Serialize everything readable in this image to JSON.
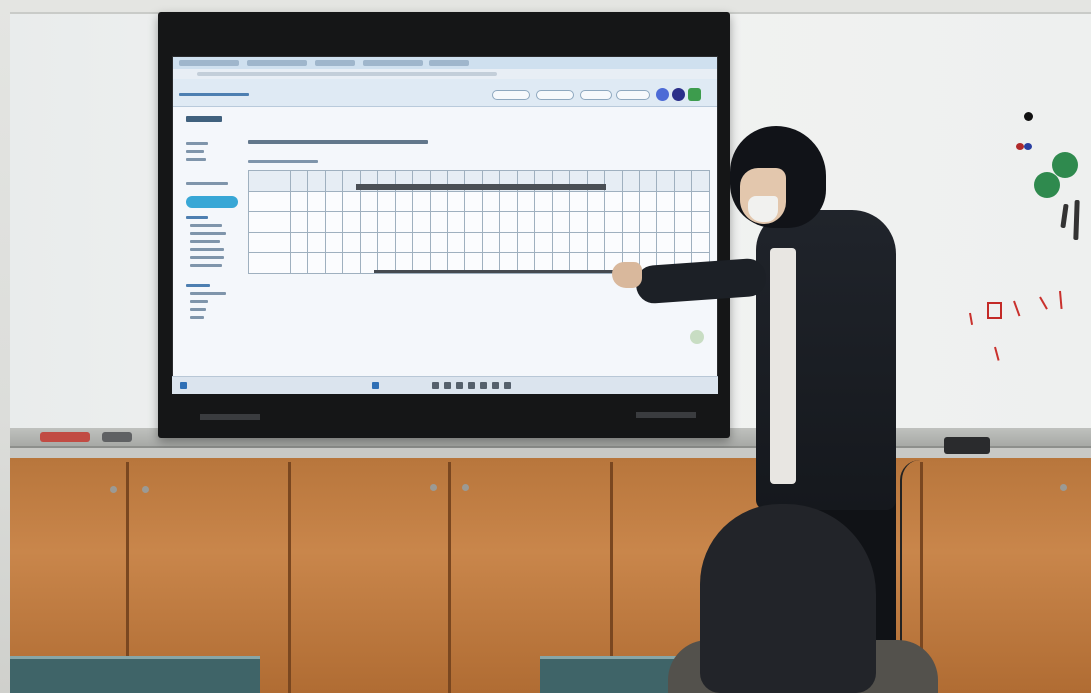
{
  "scene": {
    "description_type": "photo",
    "colors": {
      "screen_accent": "#38a7d6",
      "cabinet_wood": "#c9864b",
      "whiteboard": "#eef0ef",
      "marker_red": "#c9312d",
      "magnet_green": "#2f8a4e"
    }
  },
  "screen": {
    "icons": [
      "browser-tabs",
      "app-header",
      "user-icon",
      "settings-icon",
      "green-icon"
    ]
  }
}
